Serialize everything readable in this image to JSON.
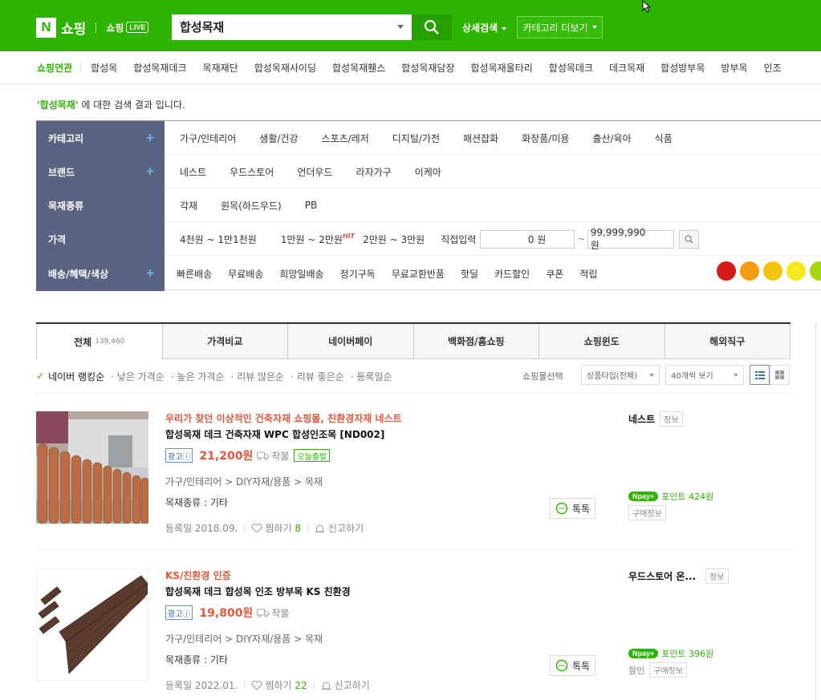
{
  "header": {
    "logo_n": "N",
    "logo_shop": "쇼핑",
    "live_label": "쇼핑",
    "live_badge": "LIVE",
    "search_value": "합성목재",
    "advanced_search": "상세검색",
    "category_more": "카테고리 더보기"
  },
  "related": {
    "label": "쇼핑연관",
    "keywords": [
      "합성목",
      "합성목재데크",
      "목재재단",
      "합성목재사이딩",
      "합성목재휀스",
      "합성목재담장",
      "합성목재울타리",
      "합성목데크",
      "데크목재",
      "합성방부목",
      "방부목",
      "인조"
    ]
  },
  "result_msg": {
    "query": "'합성목재'",
    "suffix": "에 대한 검색 결과 입니다."
  },
  "filters": {
    "category": {
      "label": "카테고리",
      "items": [
        "가구/인테리어",
        "생활/건강",
        "스포츠/레저",
        "디지털/가전",
        "패션잡화",
        "화장품/미용",
        "출산/육아",
        "식품"
      ]
    },
    "brand": {
      "label": "브랜드",
      "items": [
        "네스트",
        "우드스토어",
        "언더우드",
        "라자가구",
        "이케아"
      ]
    },
    "wood_type": {
      "label": "목재종류",
      "items": [
        "각재",
        "원목(하드우드)",
        "PB"
      ]
    },
    "price": {
      "label": "가격",
      "ranges": [
        "4천원 ~ 1만1천원",
        "1만원 ~ 2만원",
        "2만원 ~ 3만원"
      ],
      "hit": "HIT",
      "direct": "직접입력",
      "min": "0 원",
      "tilde": "~",
      "max": "99,999,990 원"
    },
    "delivery": {
      "label": "배송/혜택/색상",
      "items": [
        "빠른배송",
        "무료배송",
        "희망일배송",
        "정기구독",
        "무료교환반품",
        "핫딜",
        "카드할인",
        "쿠폰",
        "적립"
      ]
    },
    "plus": "+",
    "colors": [
      "#d6181b",
      "#f39c12",
      "#f1c40f",
      "#f7e81e",
      "#a5d611"
    ]
  },
  "tabs": [
    {
      "label": "전체",
      "count": "139,460"
    },
    {
      "label": "가격비교",
      "count": ""
    },
    {
      "label": "네이버페이",
      "count": ""
    },
    {
      "label": "백화점/홈쇼핑",
      "count": ""
    },
    {
      "label": "쇼핑윈도",
      "count": ""
    },
    {
      "label": "해외직구",
      "count": ""
    }
  ],
  "sort": {
    "options": [
      "네이버 랭킹순",
      "낮은 가격순",
      "높은 가격순",
      "리뷰 많은순",
      "리뷰 좋은순",
      "등록일순"
    ],
    "mall_select": "쇼핑몰선택",
    "product_type": "상품타입(전체)",
    "per_page": "40개씩 보기"
  },
  "products": [
    {
      "promo": "우리가 찾던 이상적인 건축자재 쇼핑몰, 친환경자재 네스트",
      "title": "합성목재 데크 건축자재 WPC 합성인조목 [ND002]",
      "ad": "광고ⓘ",
      "price": "21,200원",
      "ship": "착불",
      "today": "오늘출발",
      "path": "가구/인테리어 > DIY자재/용품 > 목재",
      "kind": "목재종류 : 기타",
      "date": "등록일 2018.09.",
      "zzim": "찜하기",
      "zzim_count": "8",
      "report": "신고하기",
      "talk": "톡톡",
      "mall": "네스트",
      "info": "정보",
      "npay": "pay+",
      "point": "포인트 424원",
      "discount": "",
      "buyinfo": "구매정보"
    },
    {
      "promo": "KS/친환경 인증",
      "title": "합성목재 데크 합성목 인조 방부목 KS 친환경",
      "ad": "광고ⓘ",
      "price": "19,800원",
      "ship": "착불",
      "today": "",
      "path": "가구/인테리어 > DIY자재/용품 > 목재",
      "kind": "목재종류 : 기타",
      "date": "등록일 2022.01.",
      "zzim": "찜하기",
      "zzim_count": "22",
      "report": "신고하기",
      "talk": "톡톡",
      "mall": "우드스토어 온...",
      "info": "정보",
      "npay": "pay+",
      "point": "포인트 396원",
      "discount": "할인",
      "buyinfo": "구매정보"
    }
  ]
}
